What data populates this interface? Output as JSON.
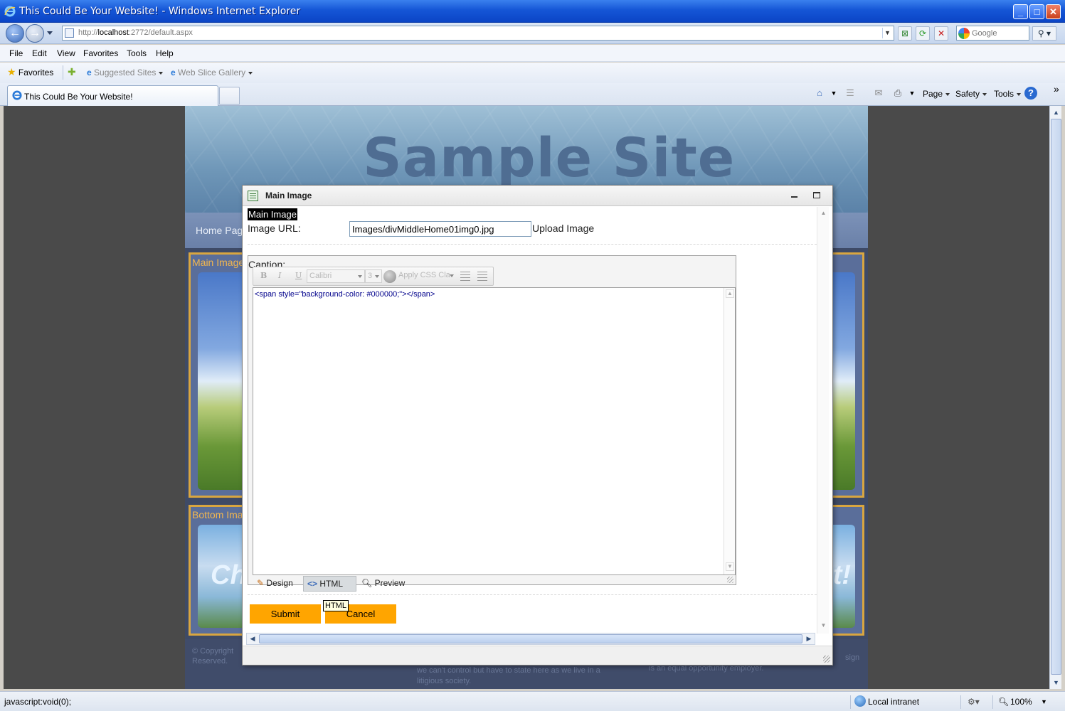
{
  "window": {
    "title": "This Could Be Your Website! - Windows Internet Explorer"
  },
  "address": {
    "scheme": "http://",
    "host": "localhost",
    "path": ":2772/default.aspx",
    "search_placeholder": "Google"
  },
  "menu": {
    "items": [
      "File",
      "Edit",
      "View",
      "Favorites",
      "Tools",
      "Help"
    ]
  },
  "favorites": {
    "label": "Favorites",
    "suggested": "Suggested Sites",
    "webslice": "Web Slice Gallery"
  },
  "tab": {
    "title": "This Could Be Your Website!"
  },
  "commands": {
    "page": "Page",
    "safety": "Safety",
    "tools": "Tools",
    "more": "»"
  },
  "site": {
    "title": "Sample Site",
    "nav_home": "Home Pag",
    "panel_main": "Main Image",
    "panel_bottom": "Bottom Ima",
    "bottom_text_left": "Ch",
    "bottom_text_right": "t!",
    "footer_left_1": "© Copyright",
    "footer_left_2": "Reserved.",
    "footer_mid_1": "we can't control but have to state here as we live in a",
    "footer_mid_2": "litigious society.",
    "footer_right": "is an equal opportunity employer.",
    "footer_far_right": "sign"
  },
  "modal": {
    "title": "Main Image",
    "heading": "Main Image",
    "image_url_label": "Image URL:",
    "image_url_value": "Images/divMiddleHome01img0.jpg",
    "upload_link": "Upload Image",
    "caption_label": "Caption:",
    "toolbar": {
      "bold": "B",
      "italic": "I",
      "underline": "U",
      "font": "Calibri",
      "size": "3",
      "css_class": "Apply CSS Cla"
    },
    "editor_content": "<span style=\"background-color: #000000;\"></span>",
    "modes": {
      "design": "Design",
      "html": "HTML",
      "preview": "Preview"
    },
    "tooltip": "HTML",
    "submit": "Submit",
    "cancel": "Cancel"
  },
  "status": {
    "left": "javascript:void(0);",
    "zone": "Local intranet",
    "zoom": "100%"
  }
}
